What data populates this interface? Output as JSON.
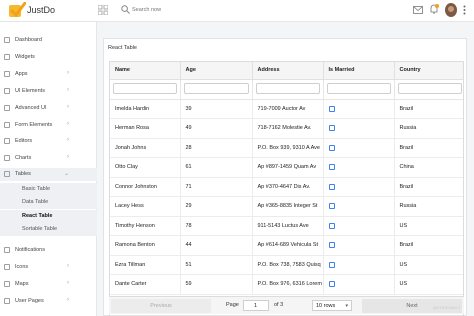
{
  "app": {
    "name": "JustDo"
  },
  "topbar": {
    "search_placeholder": "Search now"
  },
  "sidebar": {
    "items": [
      {
        "label": "Dashboard",
        "chevron": ""
      },
      {
        "label": "Widgets",
        "chevron": ""
      },
      {
        "label": "Apps",
        "chevron": "›"
      },
      {
        "label": "UI Elements",
        "chevron": "›"
      },
      {
        "label": "Advanced UI",
        "chevron": "›"
      },
      {
        "label": "Form Elements",
        "chevron": "›"
      },
      {
        "label": "Editors",
        "chevron": "›"
      },
      {
        "label": "Charts",
        "chevron": "›"
      },
      {
        "label": "Tables",
        "chevron": "⌄"
      }
    ],
    "sub_items": [
      {
        "label": "Basic Table"
      },
      {
        "label": "Data Table"
      },
      {
        "label": "React Table"
      },
      {
        "label": "Sortable Table"
      }
    ],
    "items_after": [
      {
        "label": "Notifications",
        "chevron": ""
      },
      {
        "label": "Icons",
        "chevron": "›"
      },
      {
        "label": "Maps",
        "chevron": "›"
      },
      {
        "label": "User Pages",
        "chevron": "›"
      }
    ]
  },
  "main": {
    "card_title": "React Table",
    "columns": [
      "Name",
      "Age",
      "Address",
      "Is Married",
      "Country"
    ],
    "rows": [
      [
        "Imelda Hardin",
        "39",
        "719-7009 Auctor Av",
        "",
        "Brazil"
      ],
      [
        "Herman Rosa",
        "49",
        "718-7162 Molestie Av.",
        "",
        "Russia"
      ],
      [
        "Jonah Johns",
        "28",
        "P.O. Box 939, 9310 A Ave",
        "",
        "Brazil"
      ],
      [
        "Otto Clay",
        "61",
        "Ap #897-1459 Quam Av",
        "",
        "China"
      ],
      [
        "Connor Johnston",
        "71",
        "Ap #370-4647 Dis Av.",
        "",
        "Brazil"
      ],
      [
        "Lacey Hess",
        "29",
        "Ap #365-8835 Integer St",
        "",
        "Russia"
      ],
      [
        "Timothy Henson",
        "78",
        "911-5143 Luctus Ave",
        "",
        "US"
      ],
      [
        "Ramona Benton",
        "44",
        "Ap #614-689 Vehicula St",
        "",
        "Brazil"
      ],
      [
        "Ezra Tillman",
        "51",
        "P.O. Box 738, 7583 Quisq",
        "",
        "US"
      ],
      [
        "Dante Carter",
        "59",
        "P.O. Box 976, 6316 Lorem",
        "",
        "US"
      ]
    ],
    "pagination": {
      "previous": "Previous",
      "next": "Next",
      "page_label": "Page",
      "page_value": "1",
      "of_label": "of 3",
      "rows_option": "10 rows"
    }
  },
  "watermark": "@KODEVAULT",
  "colors": {
    "checkbox_border": "#3b82f6",
    "logo_yellow": "#f5b82e",
    "notification_dot": "#f29f1f"
  }
}
